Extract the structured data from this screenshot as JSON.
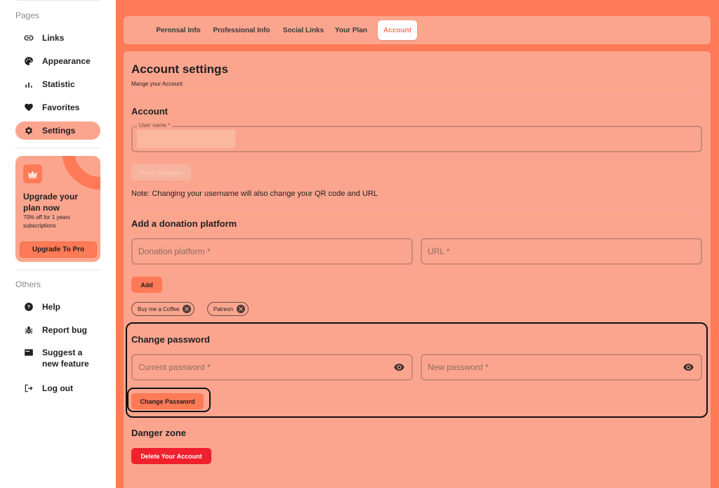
{
  "sidebar": {
    "pages_label": "Pages",
    "items": [
      {
        "label": "Links",
        "icon": "link-icon"
      },
      {
        "label": "Appearance",
        "icon": "palette-icon"
      },
      {
        "label": "Statistic",
        "icon": "bar-chart-icon"
      },
      {
        "label": "Favorites",
        "icon": "heart-icon"
      },
      {
        "label": "Settings",
        "icon": "gear-icon",
        "active": true
      }
    ],
    "promo": {
      "title": "Upgrade your plan now",
      "subtitle": "70% off for 1 years subscriptions",
      "button": "Upgrade To Pro",
      "icon": "crown-icon"
    },
    "others_label": "Others",
    "others": [
      {
        "label": "Help",
        "icon": "help-icon"
      },
      {
        "label": "Report bug",
        "icon": "bug-icon"
      },
      {
        "label": "Suggest a new feature",
        "icon": "feature-icon"
      },
      {
        "label": "Log out",
        "icon": "logout-icon"
      }
    ]
  },
  "tabs": [
    {
      "label": "Peronsal Info"
    },
    {
      "label": "Professional Info"
    },
    {
      "label": "Social Links"
    },
    {
      "label": "Your Plan"
    },
    {
      "label": "Account",
      "active": true
    }
  ],
  "account": {
    "title": "Account settings",
    "subtitle": "Mange your Account",
    "section_account": "Account",
    "username_label": "User name *",
    "save_button": "Save Changes",
    "note": "Note: Changing your username will also change your QR code and URL"
  },
  "donation": {
    "title": "Add a donation platform",
    "platform_placeholder": "Donation platform *",
    "url_placeholder": "URL *",
    "add_button": "Add",
    "chips": [
      "Buy me a Coffee",
      "Patreon"
    ]
  },
  "password": {
    "title": "Change password",
    "current_placeholder": "Current password *",
    "new_placeholder": "New password *",
    "button": "Change Password"
  },
  "danger": {
    "title": "Danger zone",
    "button": "Delete Your Account"
  },
  "colors": {
    "accent": "#ff7a57",
    "panel": "#fca58e",
    "danger": "#f0202d"
  }
}
